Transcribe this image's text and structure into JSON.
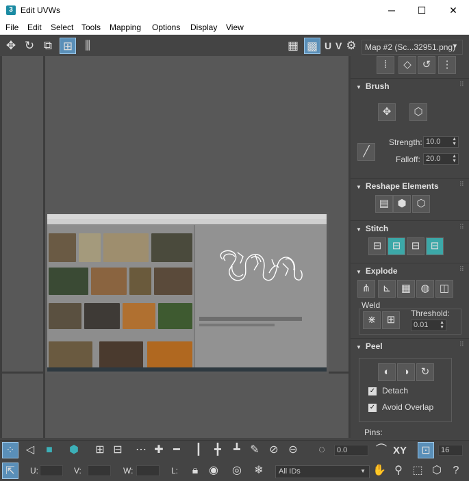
{
  "window": {
    "app_icon_label": "3",
    "title": "Edit UVWs",
    "controls": {
      "minimize": "─",
      "maximize": "☐",
      "close": "✕"
    }
  },
  "menu": [
    "File",
    "Edit",
    "Select",
    "Tools",
    "Mapping",
    "Options",
    "Display",
    "View"
  ],
  "toolbar": {
    "uv_label": "U V",
    "map_select": "Map #2 (Sc...32951.png)"
  },
  "panel": {
    "brush": {
      "title": "Brush",
      "strength_label": "Strength:",
      "strength_value": "10.0",
      "falloff_label": "Falloff:",
      "falloff_value": "20.0"
    },
    "reshape": {
      "title": "Reshape Elements"
    },
    "stitch": {
      "title": "Stitch"
    },
    "explode": {
      "title": "Explode",
      "weld_label": "Weld",
      "threshold_label": "Threshold:",
      "threshold_value": "0.01"
    },
    "peel": {
      "title": "Peel",
      "detach_label": "Detach",
      "avoid_overlap_label": "Avoid Overlap",
      "pins_label": "Pins:"
    }
  },
  "bottom": {
    "rotate_value": "0.0",
    "xy_label": "XY",
    "grid_value": "16",
    "u_label": "U:",
    "v_label": "V:",
    "w_label": "W:",
    "l_label": "L:",
    "ids_select": "All IDs"
  }
}
